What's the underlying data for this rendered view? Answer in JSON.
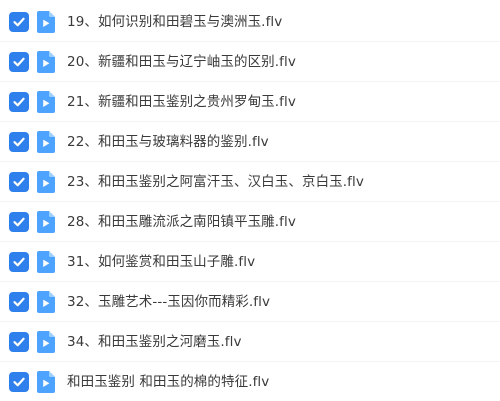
{
  "theme": {
    "checkbox_color": "#2f80ed",
    "video_icon_color": "#4da3ff",
    "video_icon_fold": "#9cd0ff",
    "text_color": "#3a3a3a"
  },
  "icons": {
    "checkbox": "checkbox-checked-icon",
    "file": "video-file-icon"
  },
  "files": [
    {
      "name": "19、如何识别和田碧玉与澳洲玉.flv",
      "checked": true
    },
    {
      "name": "20、新疆和田玉与辽宁岫玉的区别.flv",
      "checked": true
    },
    {
      "name": "21、新疆和田玉鉴别之贵州罗甸玉.flv",
      "checked": true
    },
    {
      "name": "22、和田玉与玻璃料器的鉴别.flv",
      "checked": true
    },
    {
      "name": "23、和田玉鉴别之阿富汗玉、汉白玉、京白玉.flv",
      "checked": true
    },
    {
      "name": "28、和田玉雕流派之南阳镇平玉雕.flv",
      "checked": true
    },
    {
      "name": "31、如何鉴赏和田玉山子雕.flv",
      "checked": true
    },
    {
      "name": "32、玉雕艺术---玉因你而精彩.flv",
      "checked": true
    },
    {
      "name": "34、和田玉鉴别之河磨玉.flv",
      "checked": true
    },
    {
      "name": "和田玉鉴别 和田玉的棉的特征.flv",
      "checked": true
    }
  ]
}
